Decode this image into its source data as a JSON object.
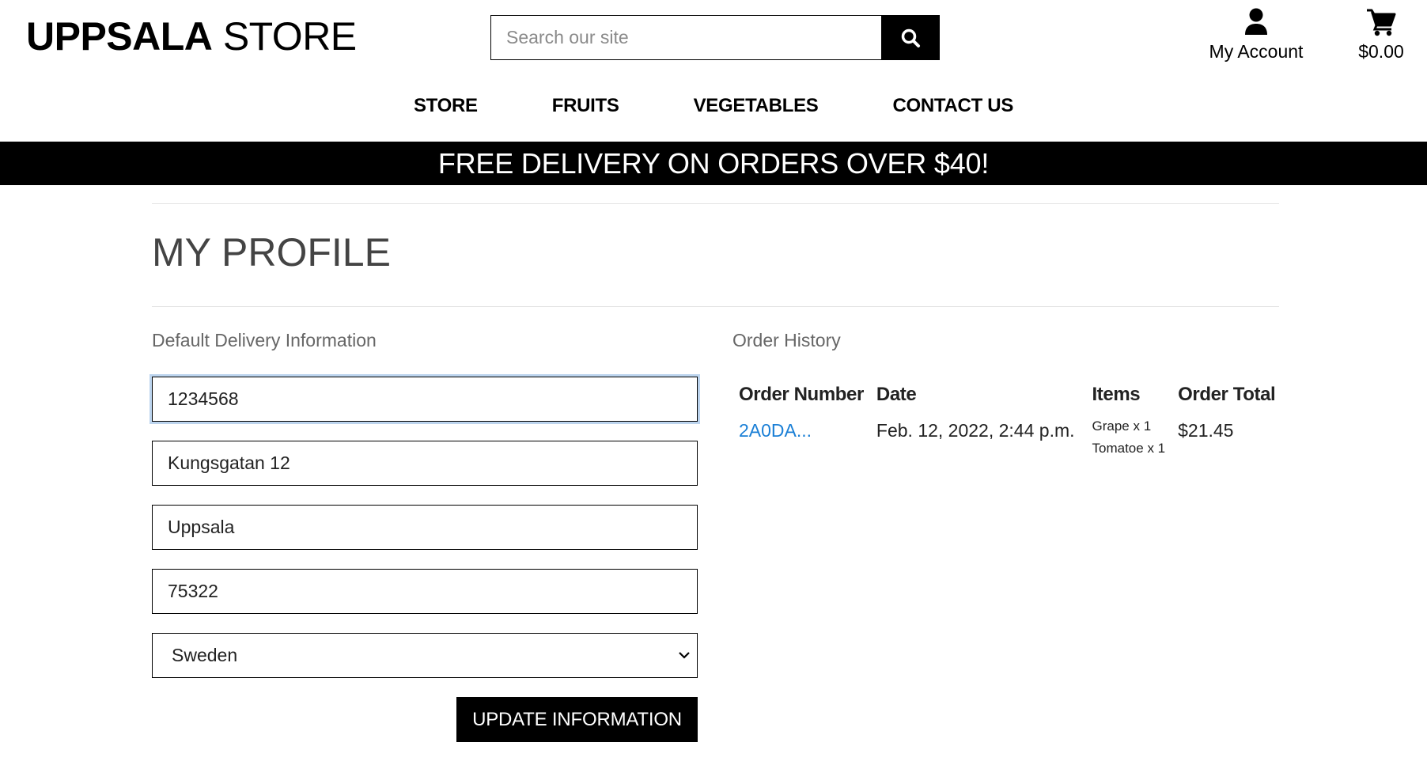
{
  "header": {
    "logo_bold": "UPPSALA",
    "logo_light": " STORE",
    "search_placeholder": "Search our site",
    "search_icon": "search-icon",
    "account_label": "My Account",
    "account_icon": "user-icon",
    "cart_total": "$0.00",
    "cart_icon": "cart-icon"
  },
  "nav": {
    "items": [
      {
        "label": "STORE"
      },
      {
        "label": "FRUITS"
      },
      {
        "label": "VEGETABLES"
      },
      {
        "label": "CONTACT US"
      }
    ]
  },
  "banner": {
    "text": "FREE DELIVERY ON ORDERS OVER $40!"
  },
  "profile": {
    "title": "MY PROFILE",
    "delivery_title": "Default Delivery Information",
    "fields": {
      "phone": "1234568",
      "street": "Kungsgatan 12",
      "city": "Uppsala",
      "postcode": "75322"
    },
    "country": "Sweden",
    "update_label": "UPDATE INFORMATION"
  },
  "orders": {
    "title": "Order History",
    "columns": [
      "Order Number",
      "Date",
      "Items",
      "Order Total"
    ],
    "rows": [
      {
        "number": "2A0DA...",
        "date": "Feb. 12, 2022, 2:44 p.m.",
        "items": [
          "Grape x 1",
          "Tomatoe x 1"
        ],
        "total": "$21.45"
      }
    ]
  },
  "colors": {
    "link": "#1a7fd6",
    "banner_bg": "#000000",
    "focus_ring": "#bcd4ee"
  }
}
